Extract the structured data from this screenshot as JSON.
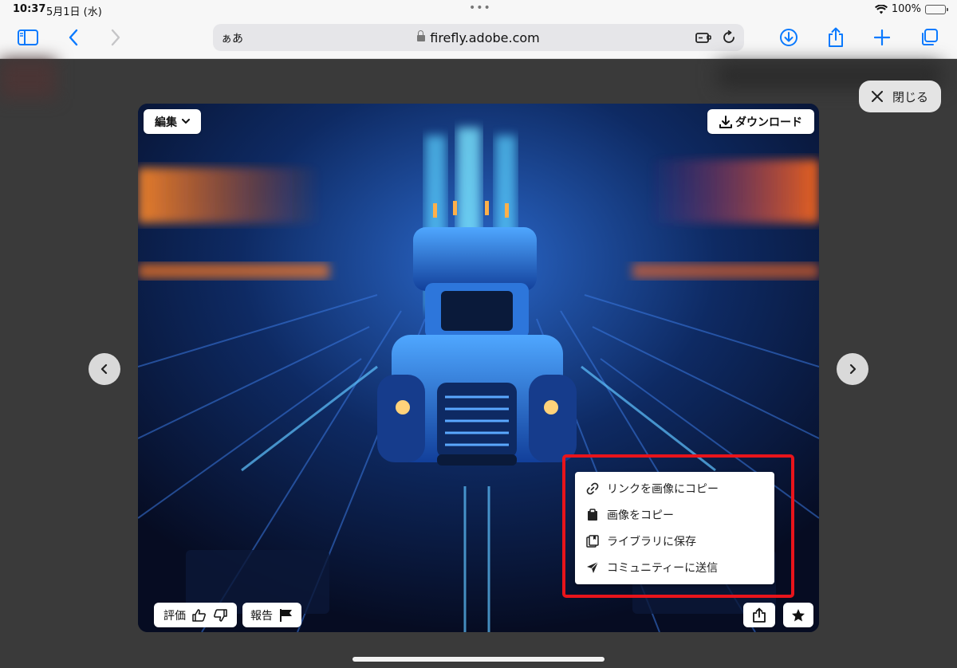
{
  "status": {
    "time": "10:37",
    "date": "5月1日 (水)",
    "battery": "100%"
  },
  "toolbar": {
    "reader_label": "ぁあ",
    "url": "firefly.adobe.com",
    "icons": [
      "sidebar-icon",
      "back-icon",
      "forward-icon",
      "extension-icon",
      "reload-icon",
      "download-icon",
      "share-icon",
      "new-tab-icon",
      "tabs-icon"
    ]
  },
  "viewer": {
    "close_label": "閉じる",
    "edit_label": "編集",
    "download_label": "ダウンロード",
    "rate_label": "評価",
    "report_label": "報告"
  },
  "share_menu": {
    "items": [
      {
        "label": "リンクを画像にコピー",
        "icon": "link-icon"
      },
      {
        "label": "画像をコピー",
        "icon": "clipboard-icon"
      },
      {
        "label": "ライブラリに保存",
        "icon": "library-icon"
      },
      {
        "label": "コミュニティーに送信",
        "icon": "send-icon"
      }
    ]
  },
  "colors": {
    "accent": "#0a7aff",
    "highlight": "#e8141b"
  }
}
